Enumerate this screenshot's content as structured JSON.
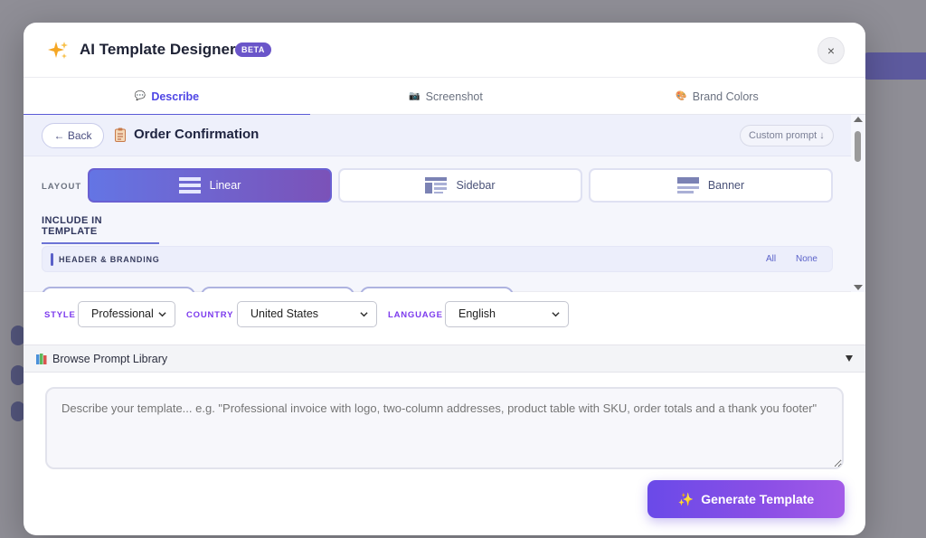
{
  "modal": {
    "title": "AI Template Designer",
    "badge": "BETA",
    "close_label": "×"
  },
  "tabs": [
    {
      "label": "Describe",
      "icon": "speech-bubble-icon",
      "active": true
    },
    {
      "label": "Screenshot",
      "icon": "camera-icon",
      "active": false
    },
    {
      "label": "Brand Colors",
      "icon": "palette-icon",
      "active": false
    }
  ],
  "detail": {
    "back_label": "← Back",
    "title": "Order Confirmation",
    "custom_prompt_label": "Custom prompt ↓"
  },
  "layout": {
    "label": "LAYOUT",
    "options": [
      {
        "label": "Linear",
        "active": true
      },
      {
        "label": "Sidebar",
        "active": false
      },
      {
        "label": "Banner",
        "active": false
      }
    ]
  },
  "include": {
    "label": "INCLUDE IN TEMPLATE",
    "sections": [
      {
        "title": "HEADER & BRANDING",
        "all_label": "All",
        "none_label": "None"
      }
    ]
  },
  "controls": {
    "style": {
      "label": "STYLE",
      "value": "Professional"
    },
    "country": {
      "label": "COUNTRY",
      "value": "United States"
    },
    "language": {
      "label": "LANGUAGE",
      "value": "English"
    }
  },
  "library": {
    "label": "Browse Prompt Library"
  },
  "prompt": {
    "placeholder": "Describe your template... e.g. \"Professional invoice with logo, two-column addresses, product table with SKU, order totals and a thank you footer\""
  },
  "generate": {
    "label": "Generate Template"
  },
  "colors": {
    "accent": "#5b5bd6",
    "label_purple": "#7c3aed"
  }
}
